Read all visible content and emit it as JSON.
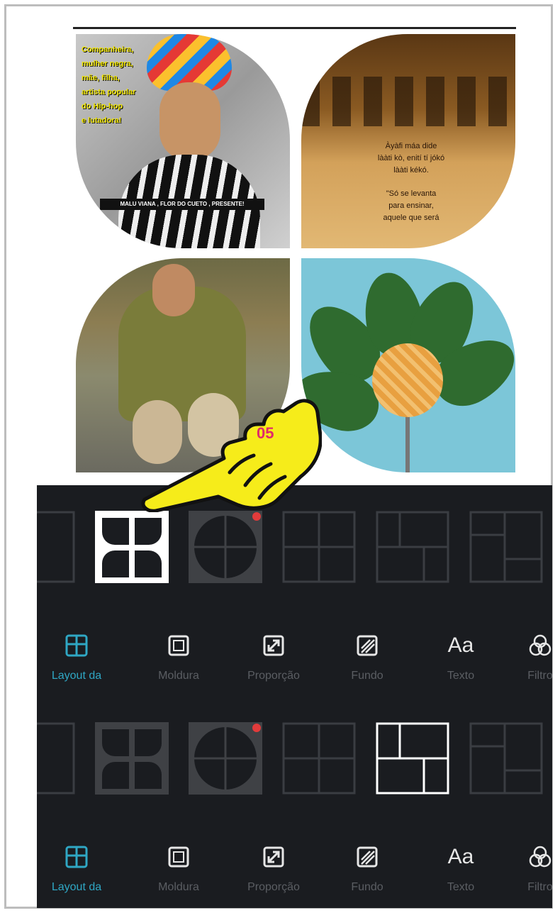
{
  "collage": {
    "tile1": {
      "poem_lines": [
        "Companheira,",
        "mulher negra,",
        "mãe, filha,",
        "artista popular",
        "do Hip-hop",
        "e lutadora!"
      ],
      "caption": "MALU VIANA , FLOR DO CUETO , PRESENTE!"
    },
    "tile2": {
      "lines_a": [
        "Àyàfi máa dide",
        "lààti kò, enití tí jókó",
        "lààti kékó."
      ],
      "lines_b": [
        "\"Só se levanta",
        "para ensinar,",
        "aquele que será"
      ]
    }
  },
  "pointer": {
    "step": "05"
  },
  "toolbar": {
    "items": [
      {
        "label": "Layout da",
        "icon": "layout-grid-icon"
      },
      {
        "label": "Moldura",
        "icon": "frame-icon"
      },
      {
        "label": "Proporção",
        "icon": "resize-icon"
      },
      {
        "label": "Fundo",
        "icon": "background-icon"
      },
      {
        "label": "Texto",
        "icon": "text-icon",
        "glyph": "Aa"
      },
      {
        "label": "Filtro",
        "icon": "filter-icon"
      }
    ]
  },
  "colors": {
    "accent": "#2fa7c4",
    "panel": "#1a1c20",
    "pointer": "#f6ec1a",
    "badge": "#e23b3b"
  }
}
